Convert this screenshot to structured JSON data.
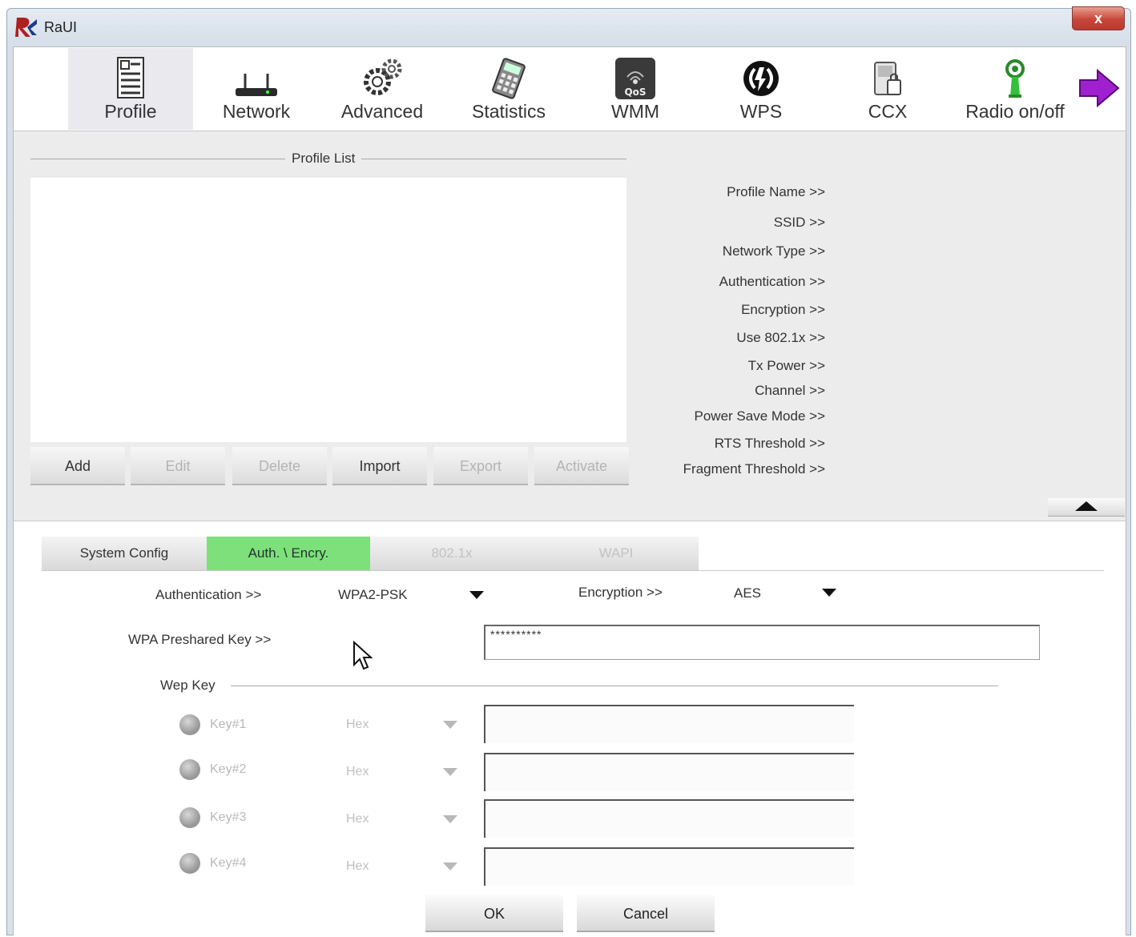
{
  "window": {
    "title": "RaUI",
    "close_glyph": "x"
  },
  "toolbar": {
    "items": [
      {
        "label": "Profile",
        "icon": "profile-icon",
        "active": true
      },
      {
        "label": "Network",
        "icon": "network-icon"
      },
      {
        "label": "Advanced",
        "icon": "advanced-icon"
      },
      {
        "label": "Statistics",
        "icon": "statistics-icon"
      },
      {
        "label": "WMM",
        "icon": "wmm-qos-icon",
        "badge": "QoS"
      },
      {
        "label": "WPS",
        "icon": "wps-icon"
      },
      {
        "label": "CCX",
        "icon": "ccx-icon"
      },
      {
        "label": "Radio on/off",
        "icon": "radio-on-off-icon"
      }
    ],
    "next_icon": "arrow-right-icon"
  },
  "profile_list": {
    "title": "Profile List",
    "buttons": [
      {
        "label": "Add",
        "enabled": true
      },
      {
        "label": "Edit",
        "enabled": false
      },
      {
        "label": "Delete",
        "enabled": false
      },
      {
        "label": "Import",
        "enabled": true
      },
      {
        "label": "Export",
        "enabled": false
      },
      {
        "label": "Activate",
        "enabled": false
      }
    ]
  },
  "profile_info": {
    "labels": [
      "Profile Name >>",
      "SSID >>",
      "Network Type >>",
      "Authentication >>",
      "Encryption >>",
      "Use 802.1x >>",
      "Tx Power >>",
      "Channel >>",
      "Power Save Mode >>",
      "RTS Threshold >>",
      "Fragment Threshold >>"
    ]
  },
  "tabs": [
    {
      "label": "System Config",
      "state": "normal"
    },
    {
      "label": "Auth. \\ Encry.",
      "state": "active"
    },
    {
      "label": "802.1x",
      "state": "disabled"
    },
    {
      "label": "WAPI",
      "state": "disabled"
    }
  ],
  "auth": {
    "authentication_label": "Authentication >>",
    "authentication_value": "WPA2-PSK",
    "encryption_label": "Encryption >>",
    "encryption_value": "AES",
    "psk_label": "WPA Preshared Key >>",
    "psk_value": "**********"
  },
  "wep": {
    "title": "Wep Key",
    "keys": [
      {
        "label": "Key#1",
        "format": "Hex"
      },
      {
        "label": "Key#2",
        "format": "Hex"
      },
      {
        "label": "Key#3",
        "format": "Hex"
      },
      {
        "label": "Key#4",
        "format": "Hex"
      }
    ]
  },
  "dialog": {
    "ok_label": "OK",
    "cancel_label": "Cancel"
  },
  "colors": {
    "active_tab": "#7ee07a",
    "close_button": "#c8463a",
    "next_arrow": "#a020d0"
  }
}
